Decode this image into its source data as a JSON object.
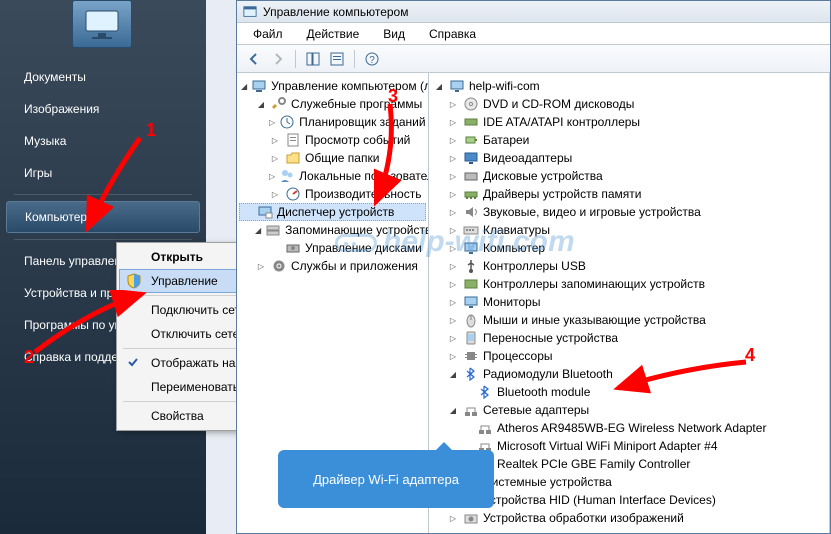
{
  "start_menu": {
    "items": [
      "Документы",
      "Изображения",
      "Музыка",
      "Игры",
      "Компьютер",
      "Панель управления",
      "Устройства и принтеры",
      "Программы по умолчанию",
      "Справка и поддержка"
    ],
    "divider_after": [
      3,
      4
    ]
  },
  "context_menu": {
    "items": [
      {
        "label": "Открыть",
        "bold": true
      },
      {
        "label": "Управление",
        "highlighted": true,
        "icon": "shield-icon"
      },
      {
        "sep": true
      },
      {
        "label": "Подключить сетевой диск..."
      },
      {
        "label": "Отключить сетевой диск..."
      },
      {
        "sep": true
      },
      {
        "label": "Отображать на рабочем столе",
        "check": true
      },
      {
        "label": "Переименовать"
      },
      {
        "sep": true
      },
      {
        "label": "Свойства"
      }
    ]
  },
  "mgmt": {
    "title": "Управление компьютером",
    "menubar": [
      "Файл",
      "Действие",
      "Вид",
      "Справка"
    ],
    "left_tree": [
      {
        "label": "Управление компьютером (локальный)",
        "ind": 0,
        "exp": "open",
        "icon": "computer-mgmt-icon"
      },
      {
        "label": "Служебные программы",
        "ind": 1,
        "exp": "open",
        "icon": "tools-icon"
      },
      {
        "label": "Планировщик заданий",
        "ind": 2,
        "exp": "closed",
        "icon": "scheduler-icon",
        "clip": true
      },
      {
        "label": "Просмотр событий",
        "ind": 2,
        "exp": "closed",
        "icon": "event-icon"
      },
      {
        "label": "Общие папки",
        "ind": 2,
        "exp": "closed",
        "icon": "shared-folders-icon"
      },
      {
        "label": "Локальные пользователи",
        "ind": 2,
        "exp": "closed",
        "icon": "users-icon",
        "clip": true
      },
      {
        "label": "Производительность",
        "ind": 2,
        "exp": "closed",
        "icon": "perf-icon"
      },
      {
        "label": "Диспетчер устройств",
        "ind": 2,
        "exp": "none",
        "icon": "device-mgr-icon",
        "sel": true
      },
      {
        "label": "Запоминающие устройства",
        "ind": 1,
        "exp": "open",
        "icon": "storage-icon",
        "clip": true
      },
      {
        "label": "Управление дисками",
        "ind": 2,
        "exp": "none",
        "icon": "disk-mgmt-icon"
      },
      {
        "label": "Службы и приложения",
        "ind": 1,
        "exp": "closed",
        "icon": "services-icon",
        "clip": true
      }
    ],
    "right_tree": [
      {
        "label": "help-wifi-com",
        "ind": 0,
        "exp": "open",
        "icon": "computer-icon"
      },
      {
        "label": "DVD и CD-ROM дисководы",
        "ind": 1,
        "exp": "closed",
        "icon": "dvd-icon"
      },
      {
        "label": "IDE ATA/ATAPI контроллеры",
        "ind": 1,
        "exp": "closed",
        "icon": "ide-icon"
      },
      {
        "label": "Батареи",
        "ind": 1,
        "exp": "closed",
        "icon": "battery-icon"
      },
      {
        "label": "Видеоадаптеры",
        "ind": 1,
        "exp": "closed",
        "icon": "display-icon"
      },
      {
        "label": "Дисковые устройства",
        "ind": 1,
        "exp": "closed",
        "icon": "disk-icon"
      },
      {
        "label": "Драйверы устройств памяти",
        "ind": 1,
        "exp": "closed",
        "icon": "memory-icon"
      },
      {
        "label": "Звуковые, видео и игровые устройства",
        "ind": 1,
        "exp": "closed",
        "icon": "sound-icon"
      },
      {
        "label": "Клавиатуры",
        "ind": 1,
        "exp": "closed",
        "icon": "keyboard-icon"
      },
      {
        "label": "Компьютер",
        "ind": 1,
        "exp": "closed",
        "icon": "computer-icon"
      },
      {
        "label": "Контроллеры USB",
        "ind": 1,
        "exp": "closed",
        "icon": "usb-icon"
      },
      {
        "label": "Контроллеры запоминающих устройств",
        "ind": 1,
        "exp": "closed",
        "icon": "storage-ctrl-icon"
      },
      {
        "label": "Мониторы",
        "ind": 1,
        "exp": "closed",
        "icon": "monitor-icon"
      },
      {
        "label": "Мыши и иные указывающие устройства",
        "ind": 1,
        "exp": "closed",
        "icon": "mouse-icon"
      },
      {
        "label": "Переносные устройства",
        "ind": 1,
        "exp": "closed",
        "icon": "portable-icon"
      },
      {
        "label": "Процессоры",
        "ind": 1,
        "exp": "closed",
        "icon": "cpu-icon"
      },
      {
        "label": "Радиомодули Bluetooth",
        "ind": 1,
        "exp": "open",
        "icon": "bluetooth-icon"
      },
      {
        "label": "Bluetooth module",
        "ind": 2,
        "exp": "none",
        "icon": "bluetooth-icon"
      },
      {
        "label": "Сетевые адаптеры",
        "ind": 1,
        "exp": "open",
        "icon": "network-icon"
      },
      {
        "label": "Atheros AR9485WB-EG Wireless Network Adapter",
        "ind": 2,
        "exp": "none",
        "icon": "network-icon"
      },
      {
        "label": "Microsoft Virtual WiFi Miniport Adapter #4",
        "ind": 2,
        "exp": "none",
        "icon": "network-icon"
      },
      {
        "label": "Realtek PCIe GBE Family Controller",
        "ind": 2,
        "exp": "none",
        "icon": "network-icon"
      },
      {
        "label": "Системные устройства",
        "ind": 1,
        "exp": "closed",
        "icon": "system-icon"
      },
      {
        "label": "Устройства HID (Human Interface Devices)",
        "ind": 1,
        "exp": "closed",
        "icon": "hid-icon"
      },
      {
        "label": "Устройства обработки изображений",
        "ind": 1,
        "exp": "closed",
        "icon": "imaging-icon"
      }
    ]
  },
  "annotations": {
    "numbers": [
      "1",
      "2",
      "3",
      "4"
    ],
    "callout": "Драйвер Wi-Fi адаптера",
    "watermark": "help-wifi.com"
  }
}
